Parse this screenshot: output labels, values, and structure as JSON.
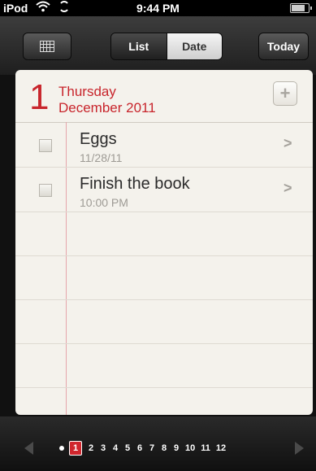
{
  "status_bar": {
    "carrier": "iPod",
    "time": "9:44 PM"
  },
  "toolbar": {
    "list_label": "List",
    "date_label": "Date",
    "today_label": "Today",
    "selected_segment": "Date"
  },
  "header": {
    "day": "1",
    "weekday": "Thursday",
    "month_year": "December 2011",
    "add_symbol": "+"
  },
  "tasks": [
    {
      "title": "Eggs",
      "subtitle": "11/28/11",
      "checked": false
    },
    {
      "title": "Finish the book",
      "subtitle": "10:00 PM",
      "checked": false
    }
  ],
  "day_strip": {
    "days": [
      "1",
      "2",
      "3",
      "4",
      "5",
      "6",
      "7",
      "8",
      "9",
      "10",
      "11",
      "12"
    ],
    "selected": "1"
  },
  "colors": {
    "accent_red": "#c8252c",
    "margin_red": "#e5a5aa",
    "paper": "#f4f2ec"
  },
  "icons": {
    "calendar": "grid-icon",
    "add": "plus-icon",
    "row": "chevron-right-icon"
  }
}
